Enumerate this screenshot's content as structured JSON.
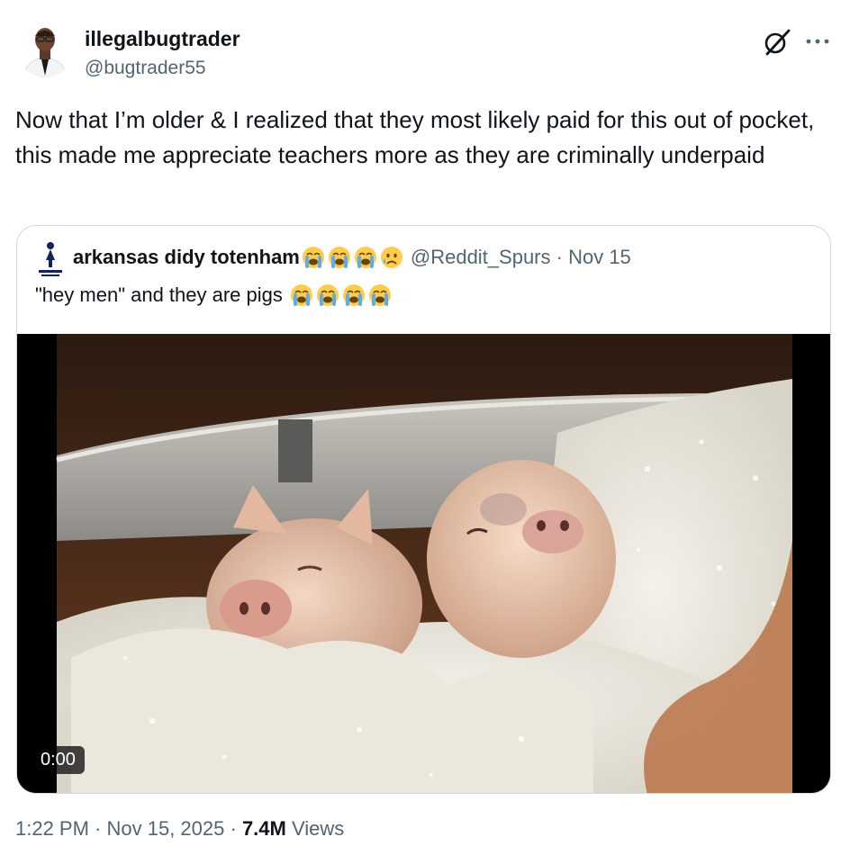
{
  "author": {
    "display_name": "illegalbugtrader",
    "handle": "@bugtrader55",
    "avatar_icon": "person-avatar"
  },
  "tweet": {
    "text": "Now that I’m older & I realized that they most likely paid for this out of pocket, this made me appreciate teachers more as they are criminally underpaid"
  },
  "quote": {
    "display_name": "arkansas didy totenham",
    "name_emojis": [
      "loudly-crying-face",
      "loudly-crying-face",
      "loudly-crying-face",
      "crying-face"
    ],
    "handle": "@Reddit_Spurs",
    "separator": " · ",
    "date": "Nov 15",
    "text": "\"hey men\" and they are pigs",
    "text_emojis": [
      "loudly-crying-face",
      "loudly-crying-face",
      "loudly-crying-face",
      "loudly-crying-face"
    ],
    "video": {
      "timestamp": "0:00"
    }
  },
  "meta": {
    "time": "1:22 PM",
    "dot": " · ",
    "date": "Nov 15, 2025",
    "dot2": " · ",
    "views_count": "7.4M",
    "views_label": " Views"
  },
  "colors": {
    "text": "#0f1419",
    "secondary": "#536471",
    "border": "#cfd9de"
  }
}
